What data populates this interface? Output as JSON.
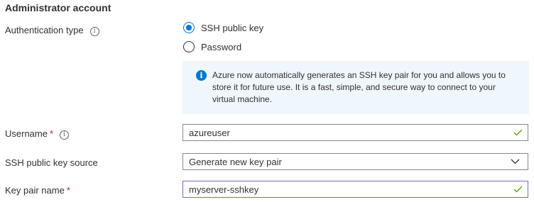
{
  "section_title": "Administrator account",
  "auth": {
    "label": "Authentication type",
    "options": [
      {
        "label": "SSH public key",
        "selected": true
      },
      {
        "label": "Password",
        "selected": false
      }
    ]
  },
  "infobox": {
    "message": "Azure now automatically generates an SSH key pair for you and allows you to store it for future use. It is a fast, simple, and secure way to connect to your virtual machine."
  },
  "username": {
    "label": "Username",
    "required_mark": "*",
    "value": "azureuser",
    "valid": true
  },
  "key_source": {
    "label": "SSH public key source",
    "value": "Generate new key pair"
  },
  "key_pair_name": {
    "label": "Key pair name",
    "required_mark": "*",
    "value": "myserver-sshkey",
    "valid": true
  },
  "colors": {
    "accent": "#0078d4",
    "valid_check": "#57a300",
    "required": "#a4262c",
    "focus_border": "#8764b8",
    "info_background": "#eff6fc"
  }
}
